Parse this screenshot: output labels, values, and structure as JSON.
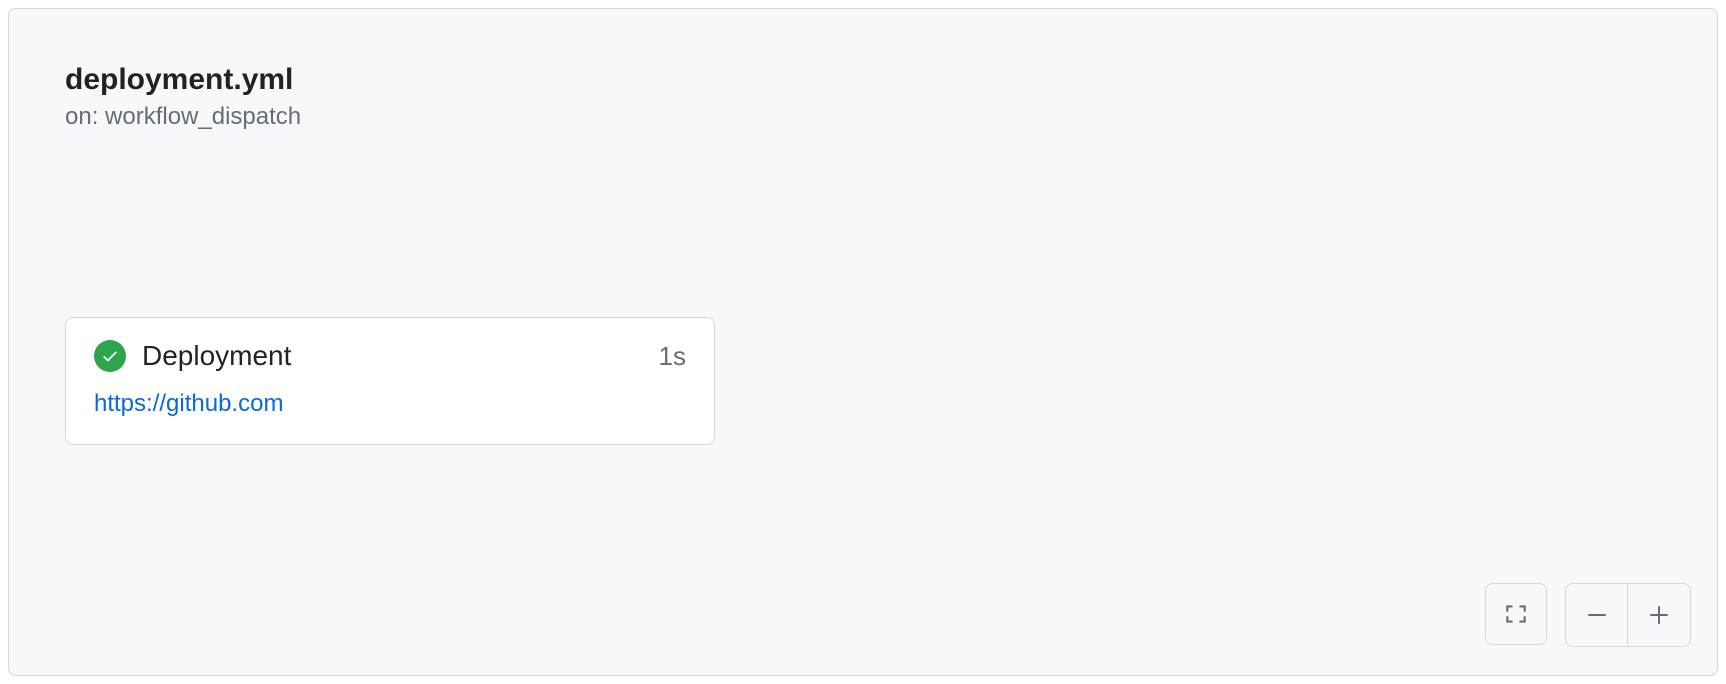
{
  "workflow": {
    "title": "deployment.yml",
    "trigger": "on: workflow_dispatch"
  },
  "job": {
    "name": "Deployment",
    "duration": "1s",
    "url": "https://github.com",
    "status": "success"
  }
}
